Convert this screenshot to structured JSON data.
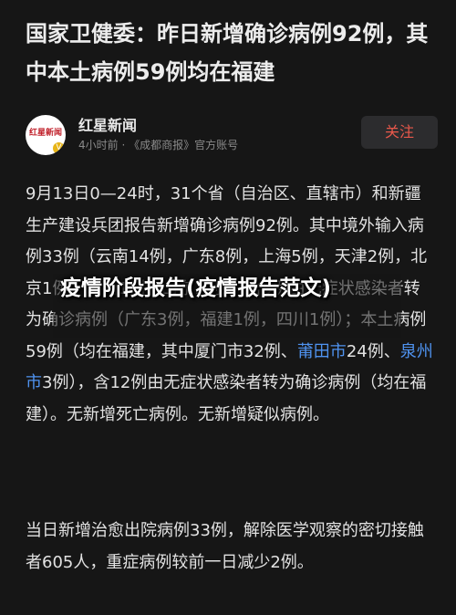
{
  "article": {
    "headline": "国家卫健委：昨日新增确诊病例92例，其中本土病例59例均在福建"
  },
  "author": {
    "avatar_logo_text": "红星新闻",
    "avatar_badge": "V",
    "name": "红星新闻",
    "meta": "4小时前 · 《成都商报》官方账号",
    "follow_label": "关注"
  },
  "body": {
    "p1_part1": "9月13日0—24时，31个省（自治区、直辖市）和新疆生产建设兵团报告新增确诊病例92例。其中境外输入病例33例（云南14例，广东8例，上海5例，天津2例，北京1例，河南1例，山东1例），含5例由无症状感染者转为确诊病例（广东3例，福建1例，四川1例）；本土病例59例（均在福建，其中厦门市32例、",
    "p1_link1": "莆田市",
    "p1_part2": "24例、",
    "p1_link2": "泉州市",
    "p1_part3": "3例），含12例由无症状感染者转为确诊病例（均在福建）。无新增死亡病例。无新增疑似病例。",
    "p2": "当日新增治愈出院病例33例，解除医学观察的密切接触者605人，重症病例较前一日减少2例。"
  },
  "overlay": {
    "title": "疫情阶段报告(疫情报告范文)"
  },
  "colors": {
    "background": "#161616",
    "link": "#4f93f0",
    "follow_text": "#e8584b"
  }
}
